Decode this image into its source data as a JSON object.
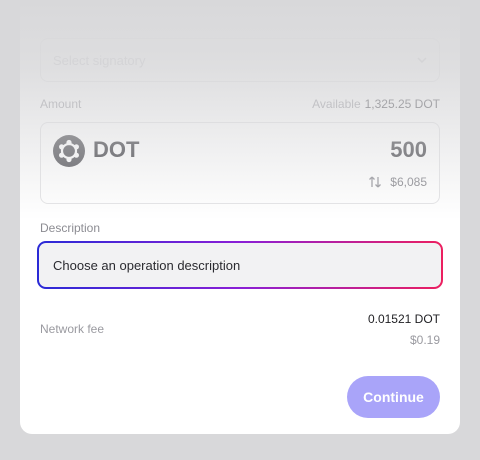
{
  "signatory": {
    "placeholder": "Select signatory",
    "chevron_icon": "chevron-down-icon"
  },
  "amount": {
    "label": "Amount",
    "available_label": "Available",
    "available_value": "1,325.25 DOT",
    "token_icon": "polkadot-token-icon",
    "token_symbol": "DOT",
    "value": "500",
    "swap_icon": "swap-arrows-icon",
    "fiat_value": "$6,085"
  },
  "description": {
    "label": "Description",
    "placeholder": "Choose an operation description",
    "focus_gradient": [
      "#2a2ad6",
      "#8a1fd6",
      "#ec1f5f"
    ]
  },
  "network_fee": {
    "label": "Network fee",
    "value": "0.01521 DOT",
    "fiat": "$0.19"
  },
  "actions": {
    "continue_label": "Continue",
    "continue_color": "#a9a4f9"
  }
}
